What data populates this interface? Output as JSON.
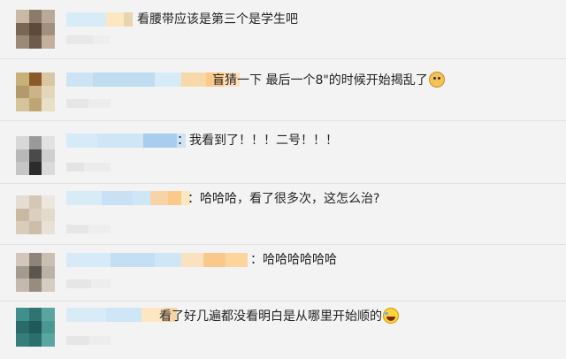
{
  "comments": [
    {
      "text": "看腰带应该是第三个是学生吧",
      "emoji": ""
    },
    {
      "text": "盲猜一下 最后一个8\"的时候开始揭乱了",
      "emoji": "dog-face-icon"
    },
    {
      "text": "：我看到了！！！二号！！！",
      "emoji": ""
    },
    {
      "text": "：哈哈哈，看了很多次，这怎么治?",
      "emoji": ""
    },
    {
      "text": "：哈哈哈哈哈哈",
      "emoji": ""
    },
    {
      "text": "看了好几遍都没看明白是从哪里开始顺的",
      "emoji": "laughing-tears-icon"
    }
  ],
  "colors": {
    "background": "#f3f3f3",
    "separator": "#e2e2e2",
    "text": "#222222",
    "blur_blue": "#cfe6f6",
    "blur_orange": "#f8c98a"
  }
}
